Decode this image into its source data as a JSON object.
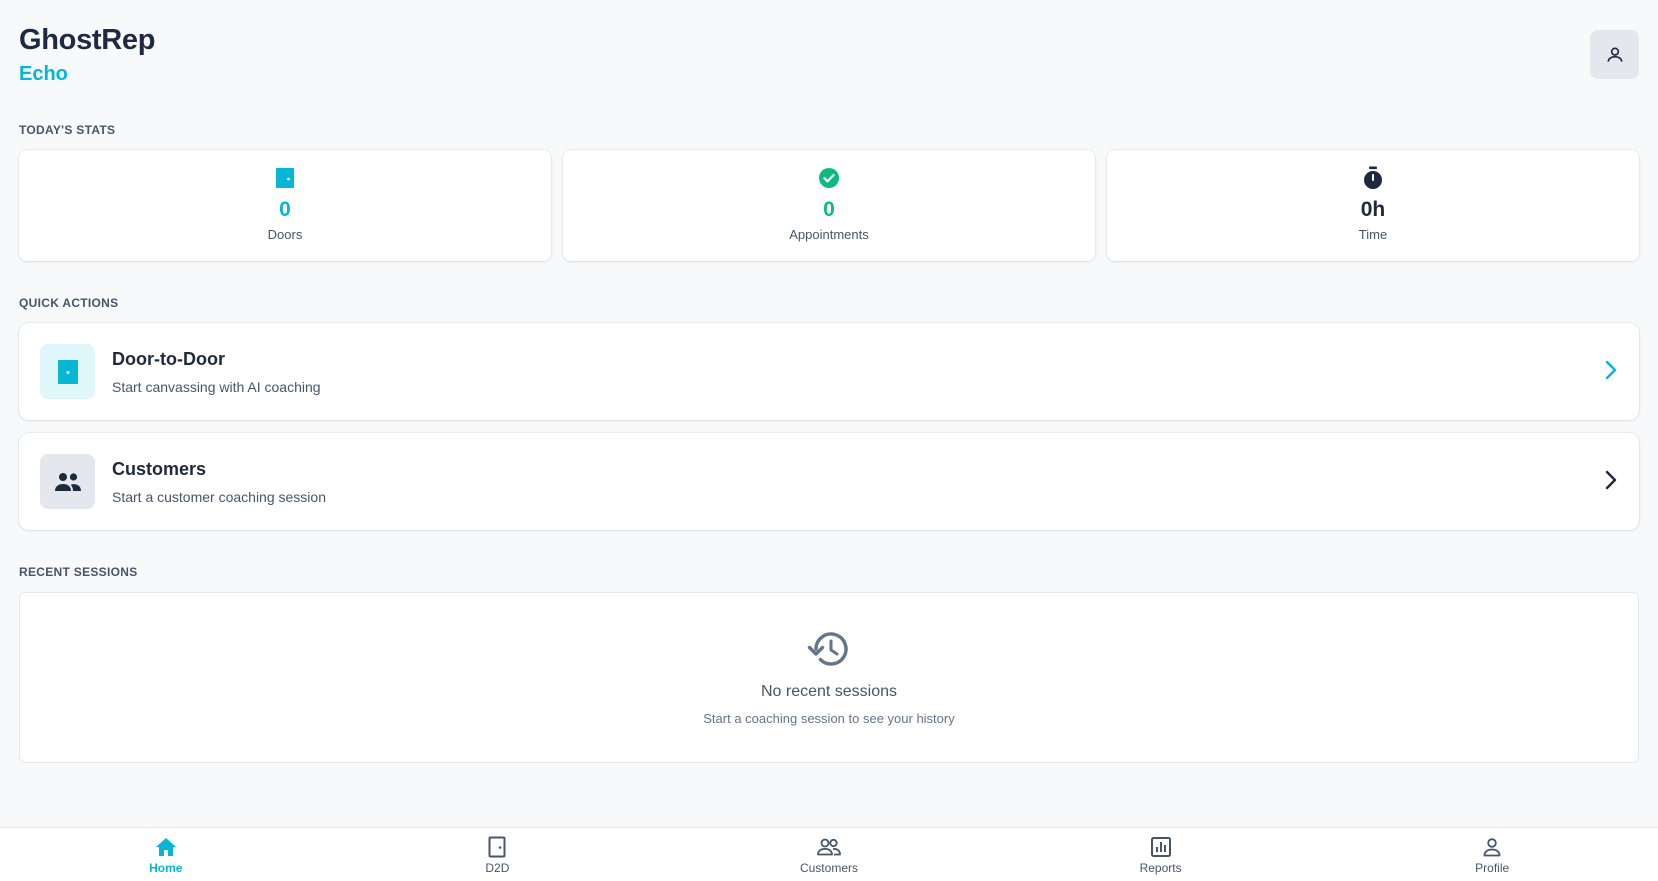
{
  "header": {
    "title": "GhostRep",
    "subtitle": "Echo"
  },
  "colors": {
    "accent": "#06b6d4",
    "success": "#10b981",
    "dark": "#1e293b"
  },
  "stats": {
    "section_label": "TODAY'S STATS",
    "items": [
      {
        "icon": "door-icon",
        "value": "0",
        "label": "Doors",
        "color": "#06b6d4"
      },
      {
        "icon": "check-circle-icon",
        "value": "0",
        "label": "Appointments",
        "color": "#10b981"
      },
      {
        "icon": "timer-icon",
        "value": "0h",
        "label": "Time",
        "color": "#1e293b"
      }
    ]
  },
  "quick_actions": {
    "section_label": "QUICK ACTIONS",
    "items": [
      {
        "icon": "door-icon",
        "title": "Door-to-Door",
        "description": "Start canvassing with AI coaching"
      },
      {
        "icon": "people-icon",
        "title": "Customers",
        "description": "Start a customer coaching session"
      }
    ]
  },
  "recent_sessions": {
    "section_label": "RECENT SESSIONS",
    "empty_title": "No recent sessions",
    "empty_description": "Start a coaching session to see your history"
  },
  "nav": {
    "items": [
      {
        "icon": "home-icon",
        "label": "Home",
        "active": true
      },
      {
        "icon": "door-outline-icon",
        "label": "D2D",
        "active": false
      },
      {
        "icon": "people-outline-icon",
        "label": "Customers",
        "active": false
      },
      {
        "icon": "reports-icon",
        "label": "Reports",
        "active": false
      },
      {
        "icon": "person-outline-icon",
        "label": "Profile",
        "active": false
      }
    ]
  }
}
